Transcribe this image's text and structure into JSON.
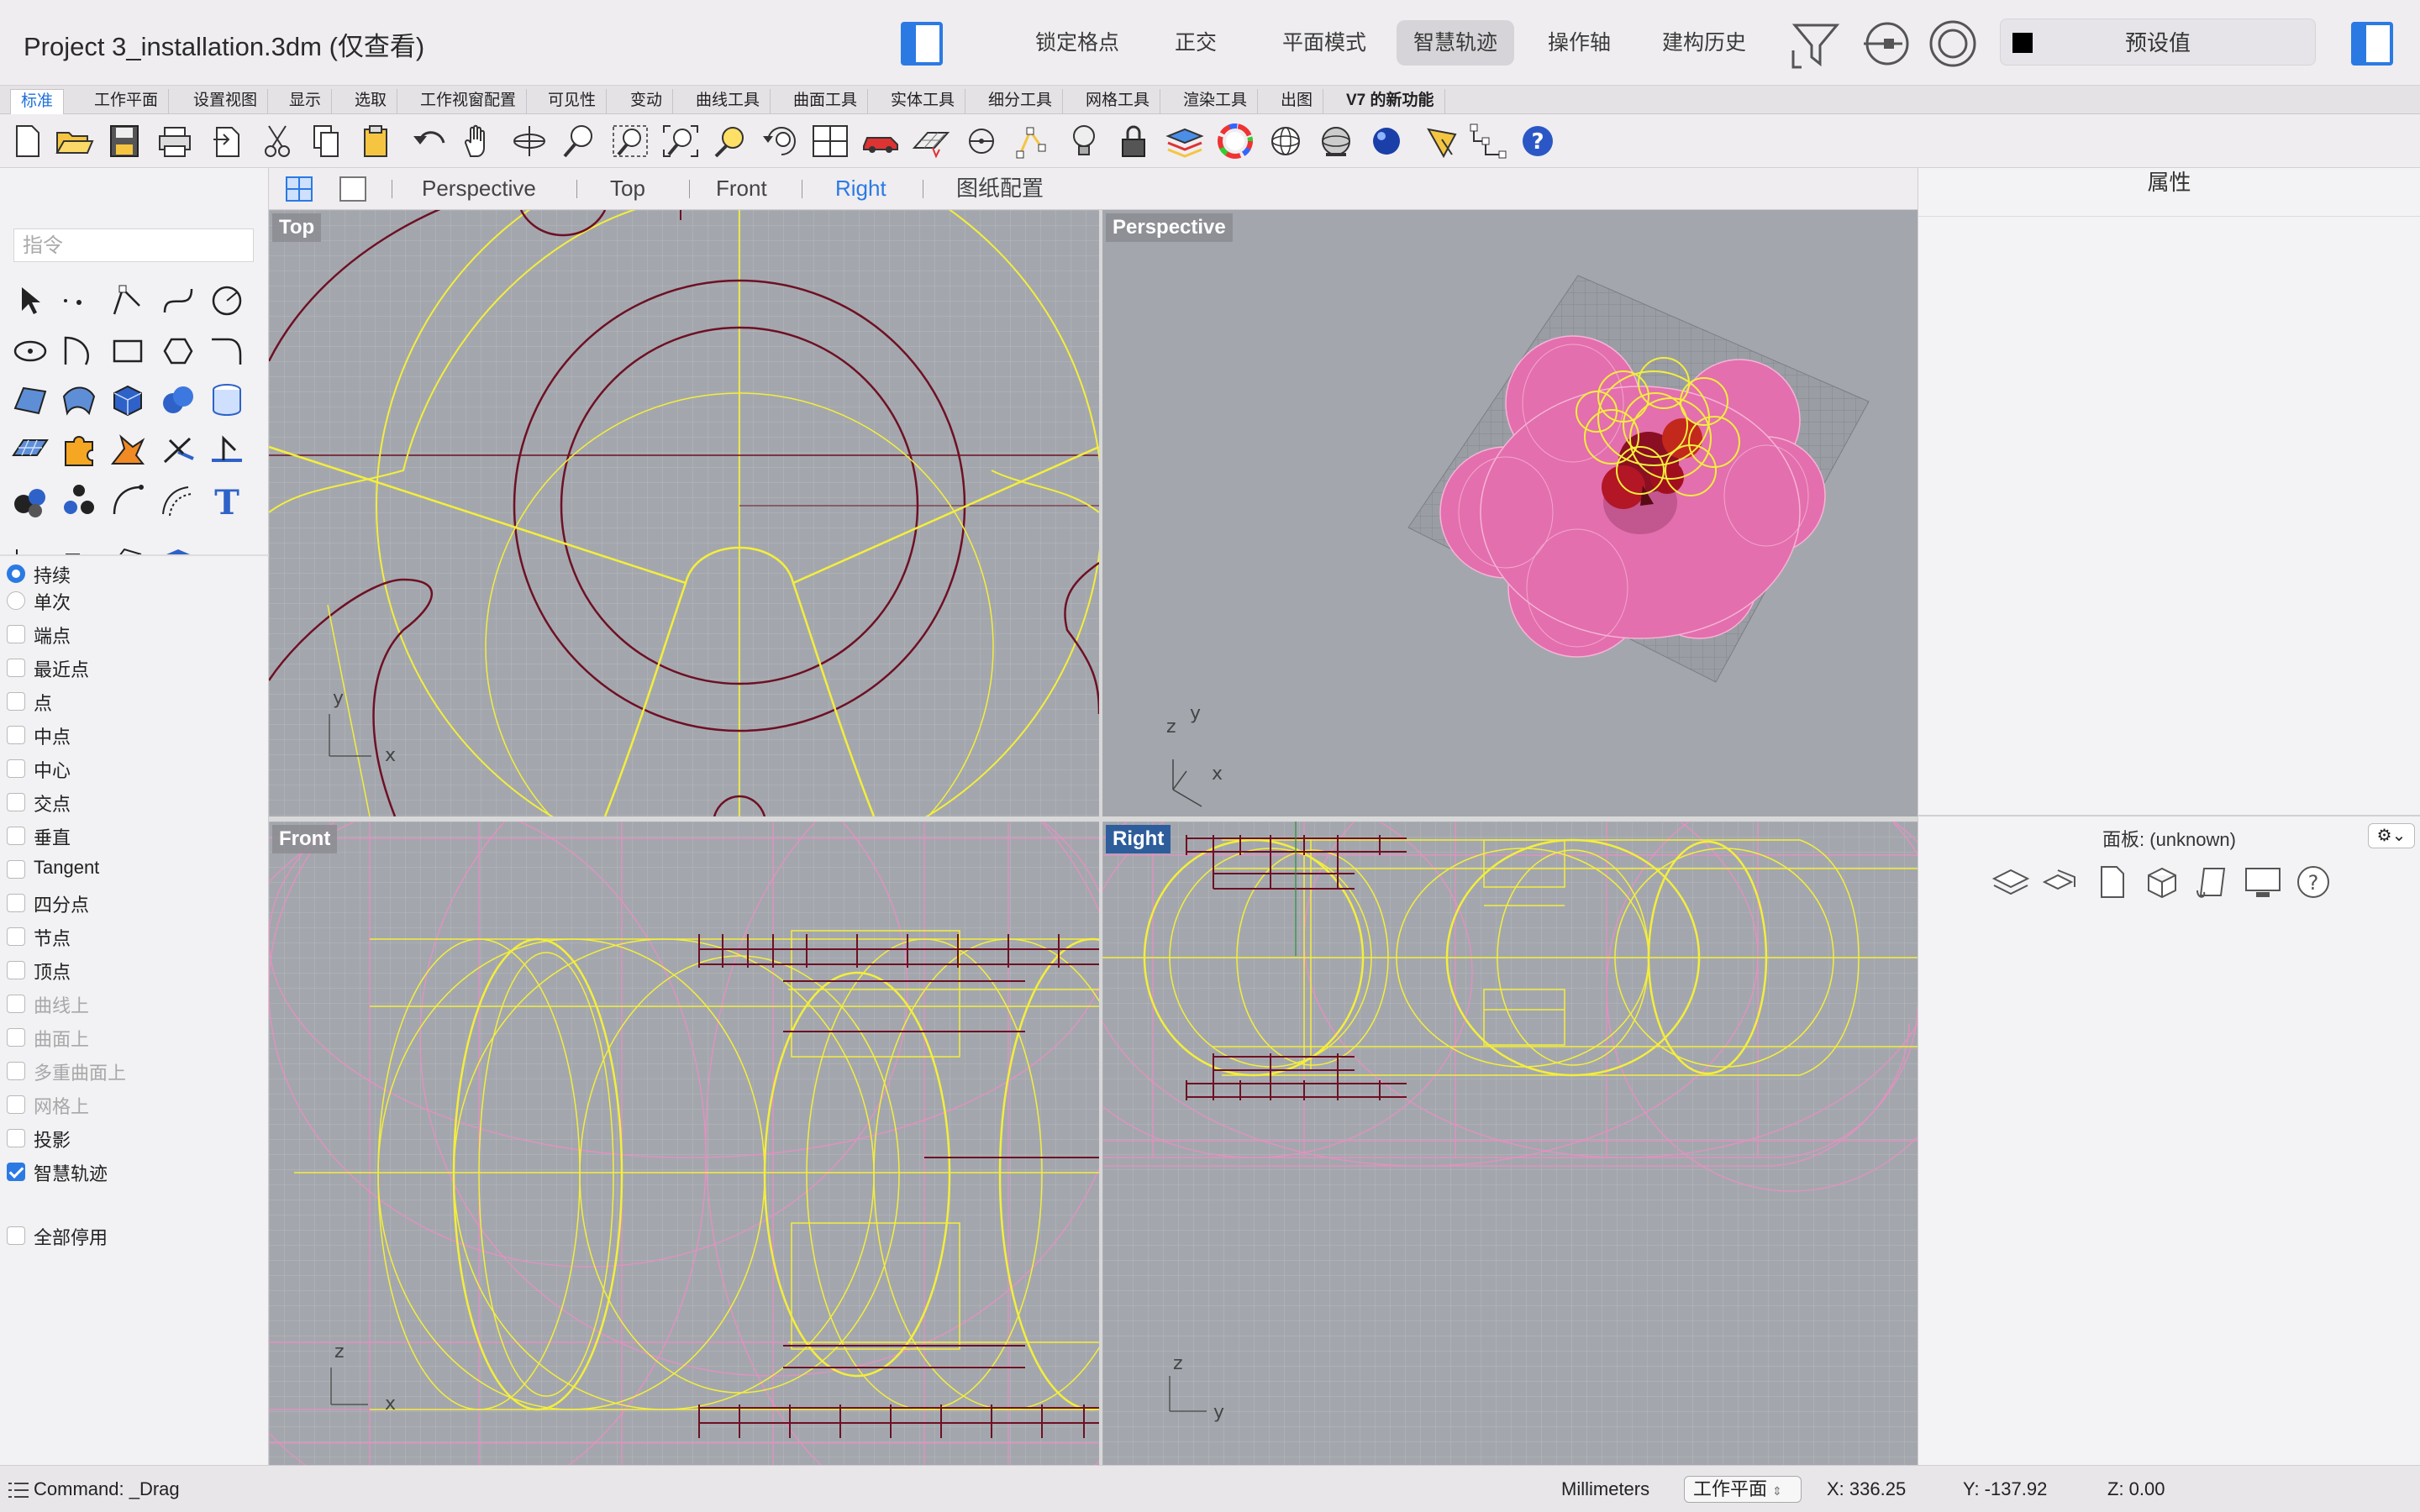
{
  "window": {
    "title": "Project 3_installation.3dm (仅查看)"
  },
  "titlebar": {
    "buttons": [
      {
        "label": "锁定格点",
        "active": false
      },
      {
        "label": "正交",
        "active": false
      },
      {
        "label": "平面模式",
        "active": false
      },
      {
        "label": "智慧轨迹",
        "active": true
      },
      {
        "label": "操作轴",
        "active": false
      },
      {
        "label": "建构历史",
        "active": false
      }
    ],
    "preset_label": "预设值",
    "preset_color": "#000000"
  },
  "tabs": [
    "标准",
    "工作平面",
    "设置视图",
    "显示",
    "选取",
    "工作视窗配置",
    "可见性",
    "变动",
    "曲线工具",
    "曲面工具",
    "实体工具",
    "细分工具",
    "网格工具",
    "渲染工具",
    "出图",
    "V7 的新功能"
  ],
  "active_tab": "标准",
  "toolbar_icons": [
    "new-file-icon",
    "open-folder-icon",
    "save-icon",
    "print-icon",
    "import-icon",
    "cut-icon",
    "copy-icon",
    "paste-icon",
    "undo-icon",
    "pan-hand-icon",
    "rotate-view-icon",
    "zoom-icon",
    "zoom-window-icon",
    "zoom-extents-icon",
    "zoom-selected-icon",
    "rotate-camera-icon",
    "four-viewports-icon",
    "car-icon",
    "grid-plane-icon",
    "snap-target-icon",
    "points-icon",
    "light-bulb-icon",
    "lock-icon",
    "layers-icon",
    "color-wheel-icon",
    "wireframe-sphere-icon",
    "shaded-sphere-icon",
    "rendered-sphere-icon",
    "pen-icon",
    "dimension-icon",
    "help-icon"
  ],
  "viewport_tabs": {
    "items": [
      "Perspective",
      "Top",
      "Front",
      "Right",
      "图纸配置"
    ],
    "active": "Right"
  },
  "left_panel": {
    "command_placeholder": "指令",
    "osnap_mode": [
      {
        "label": "持续",
        "checked": true
      },
      {
        "label": "单次",
        "checked": false
      }
    ],
    "osnaps": [
      {
        "label": "端点",
        "checked": false,
        "disabled": false
      },
      {
        "label": "最近点",
        "checked": false,
        "disabled": false
      },
      {
        "label": "点",
        "checked": false,
        "disabled": false
      },
      {
        "label": "中点",
        "checked": false,
        "disabled": false
      },
      {
        "label": "中心",
        "checked": false,
        "disabled": false
      },
      {
        "label": "交点",
        "checked": false,
        "disabled": false
      },
      {
        "label": "垂直",
        "checked": false,
        "disabled": false
      },
      {
        "label": "Tangent",
        "checked": false,
        "disabled": false
      },
      {
        "label": "四分点",
        "checked": false,
        "disabled": false
      },
      {
        "label": "节点",
        "checked": false,
        "disabled": false
      },
      {
        "label": "顶点",
        "checked": false,
        "disabled": false
      },
      {
        "label": "曲线上",
        "checked": false,
        "disabled": true
      },
      {
        "label": "曲面上",
        "checked": false,
        "disabled": true
      },
      {
        "label": "多重曲面上",
        "checked": false,
        "disabled": true
      },
      {
        "label": "网格上",
        "checked": false,
        "disabled": true
      },
      {
        "label": "投影",
        "checked": false,
        "disabled": false
      },
      {
        "label": "智慧轨迹",
        "checked": true,
        "disabled": false
      }
    ],
    "disable_all": {
      "label": "全部停用",
      "checked": false
    }
  },
  "viewports": {
    "top": {
      "label": "Top",
      "axis_x": "x",
      "axis_y": "y"
    },
    "perspective": {
      "label": "Perspective",
      "axis_x": "x",
      "axis_y": "y",
      "axis_z": "z"
    },
    "front": {
      "label": "Front",
      "axis_x": "x",
      "axis_z": "z"
    },
    "right": {
      "label": "Right",
      "axis_y": "y",
      "axis_z": "z",
      "active": true
    }
  },
  "right_panel": {
    "properties_title": "属性",
    "panel_title": "面板: (unknown)",
    "panel_icons": [
      "layers-icon",
      "display-modes-icon",
      "document-icon",
      "box-object-icon",
      "libraries-icon",
      "display-icon",
      "help-icon"
    ]
  },
  "statusbar": {
    "command": "Command: _Drag",
    "units": "Millimeters",
    "cplane": "工作平面",
    "x": "X: 336.25",
    "y": "Y: -137.92",
    "z": "Z: 0.00"
  },
  "colors": {
    "accent": "#2b7ae4",
    "viewport_bg": "#a3a7ad",
    "curve_yellow": "#f4ee3c",
    "curve_darkred": "#6e1024",
    "curve_pink": "#f08cc4",
    "surface_pink": "#e36fae"
  }
}
